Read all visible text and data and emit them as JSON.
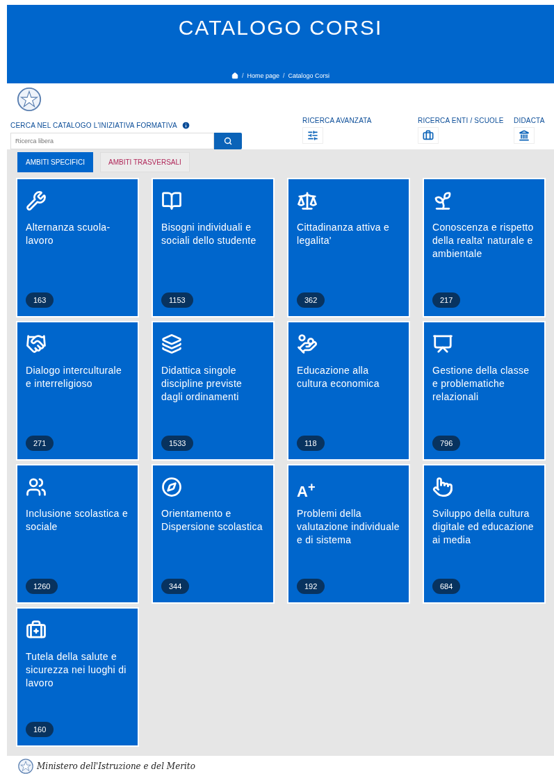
{
  "header": {
    "title": "CATALOGO CORSI",
    "breadcrumb": [
      {
        "separator": "/",
        "label": "Home page"
      },
      {
        "separator": "/",
        "label": "Catalogo Corsi"
      }
    ]
  },
  "search": {
    "label": "CERCA NEL CATALOGO L'INIZIATIVA FORMATIVA",
    "placeholder": "Ricerca libera"
  },
  "links": [
    {
      "label": "RICERCA AVANZATA"
    },
    {
      "label": "RICERCA ENTI / SCUOLE"
    },
    {
      "label": "DIDACTA"
    }
  ],
  "tabs": [
    {
      "label": "AMBITI SPECIFICI",
      "selected": true
    },
    {
      "label": "AMBITI TRASVERSALI",
      "selected": false
    }
  ],
  "cards": [
    {
      "title": "Alternanza scuola-lavoro",
      "count": "163"
    },
    {
      "title": "Bisogni individuali e sociali dello studente",
      "count": "1153"
    },
    {
      "title": "Cittadinanza attiva e legalita'",
      "count": "362"
    },
    {
      "title": "Conoscenza e rispetto della realta' naturale e ambientale",
      "count": "217"
    },
    {
      "title": "Dialogo interculturale e interreligioso",
      "count": "271"
    },
    {
      "title": "Didattica singole discipline previste dagli ordinamenti",
      "count": "1533"
    },
    {
      "title": "Educazione alla cultura economica",
      "count": "118"
    },
    {
      "title": "Gestione della classe e problematiche relazionali",
      "count": "796"
    },
    {
      "title": "Inclusione scolastica e sociale",
      "count": "1260"
    },
    {
      "title": "Orientamento e Dispersione scolastica",
      "count": "344"
    },
    {
      "title": "Problemi della valutazione individuale e di sistema",
      "count": "192",
      "mark": "A$^{+}$"
    },
    {
      "title": "Sviluppo della cultura digitale ed educazione ai media",
      "count": "684"
    },
    {
      "title": "Tutela della salute e sicurezza nei luoghi di lavoro",
      "count": "160"
    }
  ],
  "footer": {
    "text": "Ministero dell'Istruzione e del Merito"
  }
}
